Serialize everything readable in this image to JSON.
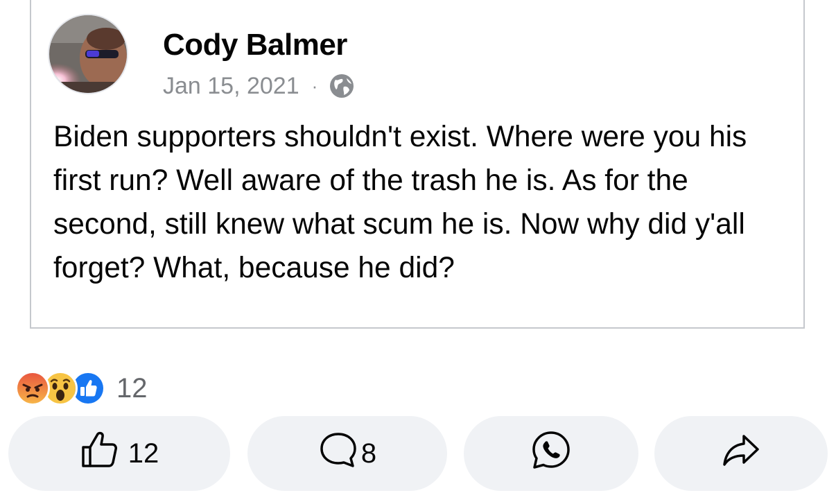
{
  "post": {
    "author": "Cody Balmer",
    "date": "Jan 15, 2021",
    "separator": "·",
    "privacy_icon": "globe-icon",
    "text": "Biden supporters shouldn't exist. Where were you his first run? Well aware of the trash he is. As for the second, still knew what scum he is. Now why did y'all forget? What, because he did?"
  },
  "reactions": {
    "icons": [
      "angry-reaction-icon",
      "wow-reaction-icon",
      "like-reaction-icon"
    ],
    "count": "12"
  },
  "actions": {
    "like": {
      "icon": "thumbs-up-icon",
      "count": "12"
    },
    "comment": {
      "icon": "comment-bubble-icon",
      "count": "8"
    },
    "whatsapp": {
      "icon": "whatsapp-icon"
    },
    "share": {
      "icon": "share-arrow-icon"
    }
  },
  "colors": {
    "like_blue": "#1877f2",
    "angry_red": "#e9573f",
    "wow_yellow": "#f7c444",
    "muted_text": "#65676b",
    "button_bg": "#f0f2f5"
  }
}
